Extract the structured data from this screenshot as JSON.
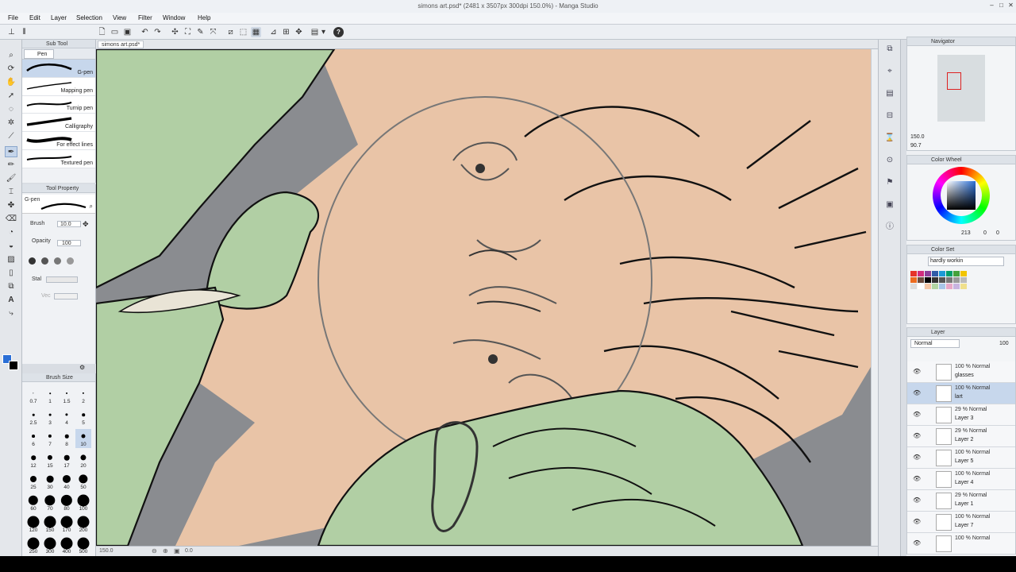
{
  "window": {
    "title": "simons art.psd* (2481 x 3507px 300dpi 150.0%) - Manga Studio"
  },
  "menu": [
    "File",
    "Edit",
    "Layer",
    "Selection",
    "View",
    "Filter",
    "Window",
    "Help"
  ],
  "subtool": {
    "title": "Sub Tool",
    "active_tab": "Pen",
    "brushes": [
      "G-pen",
      "Mapping pen",
      "Turnip pen",
      "Calligraphy",
      "For effect lines",
      "Textured pen"
    ]
  },
  "tool_property": {
    "title": "Tool Property",
    "current": "G-pen",
    "brush_label": "Brush",
    "brush_value": "10.0",
    "opacity_label": "Opacity",
    "opacity_value": "100",
    "stab_label": "Stal",
    "vec_label": "Vec"
  },
  "brush_size": {
    "title": "Brush Size",
    "values": [
      "0.7",
      "1",
      "1.5",
      "2",
      "2.5",
      "3",
      "4",
      "5",
      "6",
      "7",
      "8",
      "10",
      "12",
      "15",
      "17",
      "20",
      "25",
      "30",
      "40",
      "50",
      "60",
      "70",
      "80",
      "100",
      "120",
      "150",
      "170",
      "200",
      "250",
      "300",
      "400",
      "500"
    ]
  },
  "document": {
    "tab": "simons art.psd*",
    "zoom": "150.0",
    "rotation": "0.0"
  },
  "navigator": {
    "title": "Navigator",
    "zoom": "150.0",
    "angle": "90.7"
  },
  "color_wheel": {
    "title": "Color Wheel",
    "h": "213",
    "s": "0",
    "v": "0"
  },
  "color_set": {
    "title": "Color Set",
    "set_name": "hardly workin",
    "colors": [
      "#e6332a",
      "#d02e7e",
      "#8b3f9a",
      "#2f5ca8",
      "#1d9ad6",
      "#009f6b",
      "#45a23a",
      "#f2c500",
      "#ec6b1f",
      "#6d4c3d",
      "#000000",
      "#333333",
      "#555555",
      "#777777",
      "#999999",
      "#bbbbbb",
      "#dddddd",
      "#ffffff",
      "#f5c6a5",
      "#b3d6a4",
      "#a8c5e8",
      "#e8a8c8",
      "#c8b4e0",
      "#f0e08c"
    ]
  },
  "layers": {
    "title": "Layer",
    "blend_mode": "Normal",
    "opacity": "100",
    "items": [
      {
        "pct": "100 %",
        "mode": "Normal",
        "name": "glasses"
      },
      {
        "pct": "100 %",
        "mode": "Normal",
        "name": "lart"
      },
      {
        "pct": "29 %",
        "mode": "Normal",
        "name": "Layer 3"
      },
      {
        "pct": "29 %",
        "mode": "Normal",
        "name": "Layer 2"
      },
      {
        "pct": "100 %",
        "mode": "Normal",
        "name": "Layer 5"
      },
      {
        "pct": "100 %",
        "mode": "Normal",
        "name": "Layer 4"
      },
      {
        "pct": "29 %",
        "mode": "Normal",
        "name": "Layer 1"
      },
      {
        "pct": "100 %",
        "mode": "Normal",
        "name": "Layer 7"
      },
      {
        "pct": "100 %",
        "mode": "Normal",
        "name": ""
      }
    ]
  },
  "colors": {
    "main": "#2b6fd6",
    "sub": "#000000",
    "skin": "#e9c4a7",
    "green": "#b1cfa4",
    "bg": "#8a8c90"
  }
}
